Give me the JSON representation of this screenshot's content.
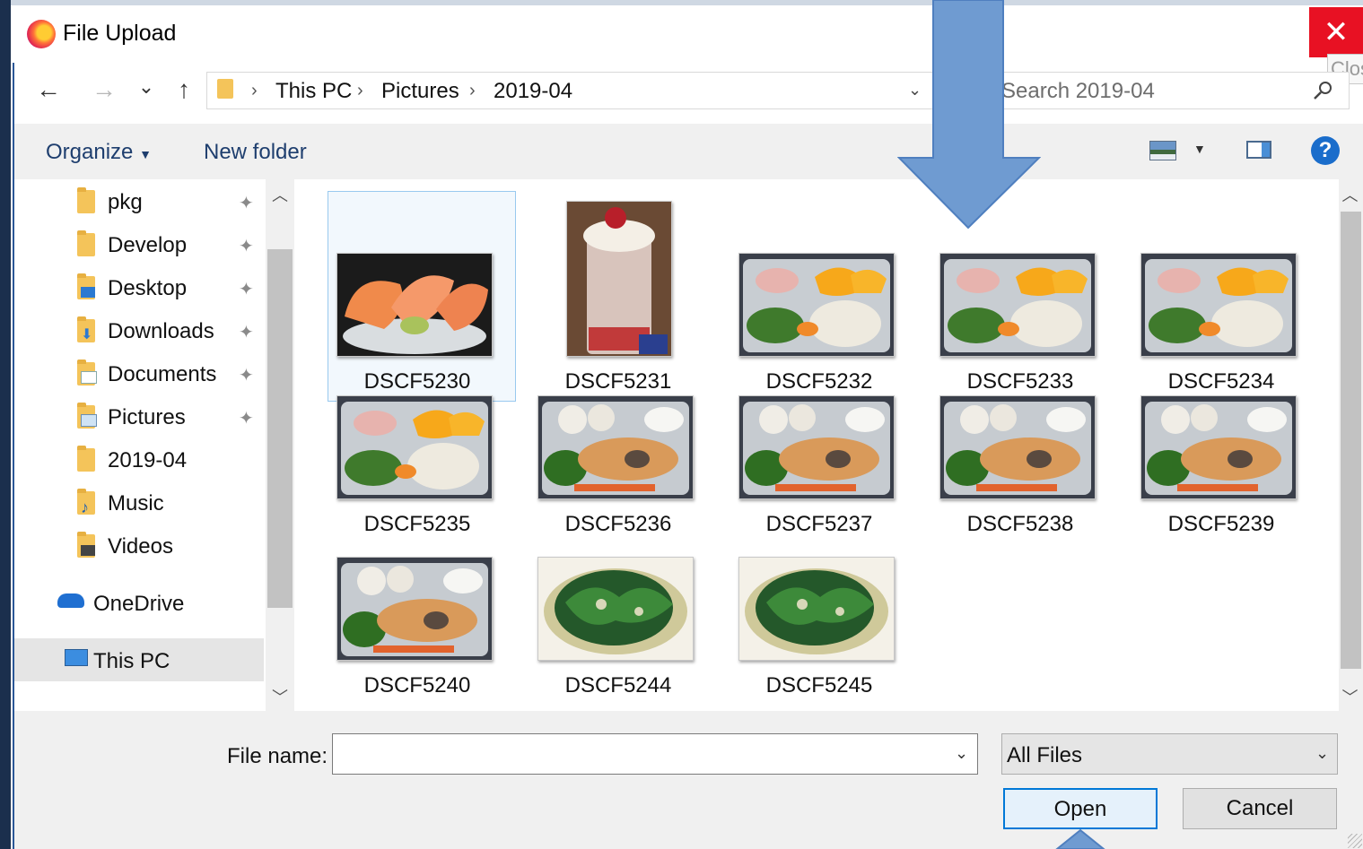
{
  "window": {
    "title": "File Upload",
    "close_tooltip": "Close"
  },
  "nav_buttons": {
    "back": "←",
    "forward": "→",
    "recent": "⌄",
    "up": "↑"
  },
  "address_bar": {
    "crumbs": [
      "This PC",
      "Pictures",
      "2019-04"
    ],
    "separator": "›"
  },
  "search": {
    "placeholder": "Search 2019-04"
  },
  "toolbar": {
    "organize": "Organize",
    "new_folder": "New folder",
    "help": "?"
  },
  "nav_pane": {
    "items": [
      {
        "label": "pkg",
        "pinned": true
      },
      {
        "label": "Develop",
        "pinned": true
      },
      {
        "label": "Desktop",
        "pinned": true
      },
      {
        "label": "Downloads",
        "pinned": true
      },
      {
        "label": "Documents",
        "pinned": true
      },
      {
        "label": "Pictures",
        "pinned": true
      },
      {
        "label": "2019-04",
        "pinned": false
      },
      {
        "label": "Music",
        "pinned": false
      },
      {
        "label": "Videos",
        "pinned": false
      },
      {
        "label": "OneDrive",
        "pinned": false
      },
      {
        "label": "This PC",
        "pinned": false,
        "selected": true
      }
    ],
    "pin_glyph": "📌"
  },
  "files": [
    {
      "name": "DSCF5230",
      "kind": "salmon"
    },
    {
      "name": "DSCF5231",
      "kind": "drink"
    },
    {
      "name": "DSCF5232",
      "kind": "bento-orange"
    },
    {
      "name": "DSCF5233",
      "kind": "bento-orange"
    },
    {
      "name": "DSCF5234",
      "kind": "bento-orange"
    },
    {
      "name": "DSCF5235",
      "kind": "bento-orange"
    },
    {
      "name": "DSCF5236",
      "kind": "bento-chicken"
    },
    {
      "name": "DSCF5237",
      "kind": "bento-chicken"
    },
    {
      "name": "DSCF5238",
      "kind": "bento-chicken"
    },
    {
      "name": "DSCF5239",
      "kind": "bento-chicken"
    },
    {
      "name": "DSCF5240",
      "kind": "bento-chicken"
    },
    {
      "name": "DSCF5244",
      "kind": "greens"
    },
    {
      "name": "DSCF5245",
      "kind": "greens"
    }
  ],
  "bottom": {
    "file_name_label": "File name:",
    "file_name_value": "",
    "file_type": "All Files",
    "open": "Open",
    "cancel": "Cancel"
  },
  "colors": {
    "accent": "#0078d7",
    "close": "#e81123",
    "annotation_arrow": "#6f9bd1"
  }
}
